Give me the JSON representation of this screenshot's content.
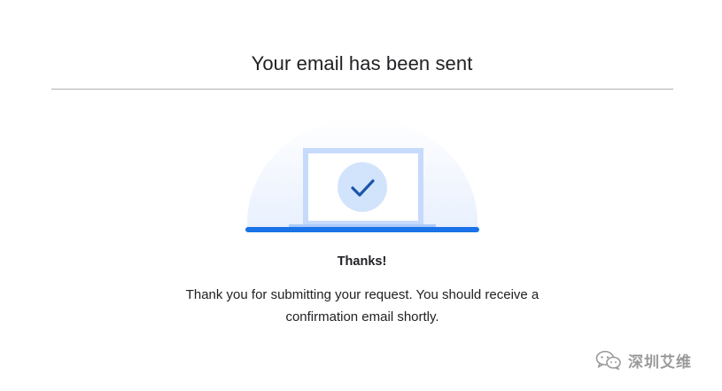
{
  "dialog": {
    "title": "Your email has been sent",
    "thanks": "Thanks!",
    "message": "Thank you for submitting your request. You should receive a confirmation email shortly."
  },
  "illustration": {
    "icon": "laptop-with-checkmark-icon",
    "accent_color": "#1a73e8",
    "check_circle_color": "#d2e3fc",
    "check_color": "#1a56a8"
  },
  "watermark": {
    "icon": "wechat-icon",
    "text": "深圳艾维"
  }
}
